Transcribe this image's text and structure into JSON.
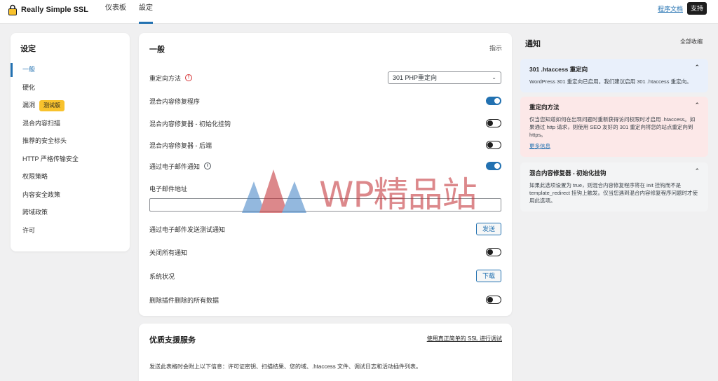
{
  "app": {
    "name": "Really Simple SSL"
  },
  "topnav": {
    "dashboard": "仪表板",
    "settings": "設定"
  },
  "header": {
    "docs": "程序文档",
    "support": "支持"
  },
  "sidebar": {
    "title": "设定",
    "items": [
      {
        "label": "一般",
        "active": true
      },
      {
        "label": "硬化"
      },
      {
        "label": "漏洞",
        "badge": "测试版"
      },
      {
        "label": "混合内容扫描"
      },
      {
        "label": "推荐的安全标头"
      },
      {
        "label": "HTTP 严格传输安全"
      },
      {
        "label": "权限策略"
      },
      {
        "label": "内容安全政策"
      },
      {
        "label": "跨域政策"
      },
      {
        "label": "许可"
      }
    ]
  },
  "general": {
    "title": "一般",
    "action": "指示",
    "redirect_label": "重定向方法",
    "redirect_value": "301 PHP重定向",
    "mixed_fixer": "混合内容修复程序",
    "mixed_fixer_init": "混合内容修复器 - 初始化挂钩",
    "mixed_fixer_back": "混合内容修复器 - 后端",
    "email_notify": "通过电子邮件通知",
    "email_address_label": "电子邮件地址",
    "email_address_value": "",
    "email_test": "通过电子邮件发送测试通知",
    "send_btn": "发送",
    "disable_notices": "关闭所有通知",
    "system_status": "系统状况",
    "download_btn": "下载",
    "delete_data": "删除插件删除的所有数据",
    "toggles": {
      "mixed_fixer": true,
      "mixed_fixer_init": false,
      "mixed_fixer_back": false,
      "email_notify": true,
      "disable_notices": false,
      "delete_data": false
    }
  },
  "premium": {
    "title": "优质支援服务",
    "link": "使用真正简单的 SSL 进行调试",
    "desc": "发送此表格时会附上以下信息：许可证密钥、扫描结果、您的域、.htaccess 文件、调试日志和活动插件列表。"
  },
  "notifications": {
    "title": "通知",
    "collapse_all": "全部收缩",
    "items": [
      {
        "title": "301 .htaccess 重定向",
        "body": "WordPress 301 重定向已启用。我们建议启用 301 .htaccess 重定向。",
        "more": ""
      },
      {
        "title": "重定向方法",
        "body": "仅当您知道如何在出现问题时重新获得访问权限时才启用 .htaccess。如果通过 http 请求，则使用 SEO 友好的 301 重定向将您的站点重定向到 https。",
        "more": "更多信息"
      },
      {
        "title": "混合内容修复器 - 初始化挂钩",
        "body": "如果此选项设置为 true，则混合内容修复程序将在 init 挂钩而不是 template_redirect 挂钩上触发。仅当您遇到混合内容修复程序问题时才使用此选项。",
        "more": ""
      }
    ]
  },
  "watermark": {
    "text": "WP精品站"
  },
  "colors": {
    "accent": "#2271b1",
    "beta": "#f8c22d",
    "danger": "#d63638"
  }
}
